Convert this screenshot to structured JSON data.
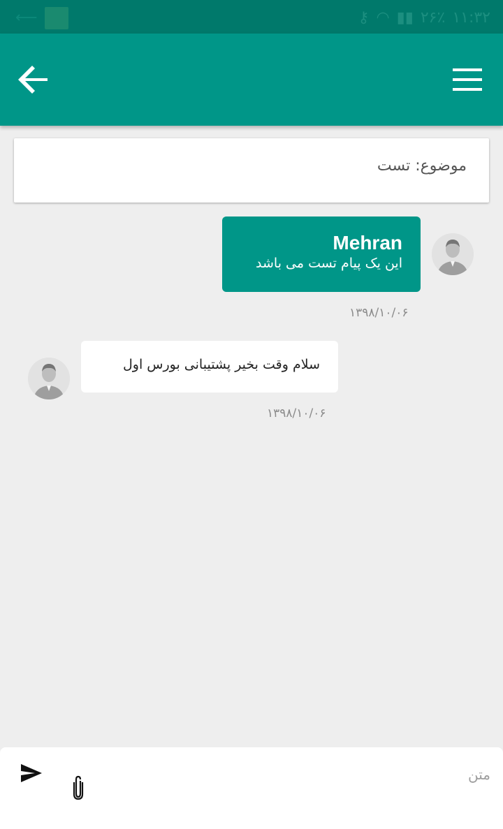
{
  "status_bar": {
    "time": "۱۱:۳۲",
    "battery": "۲۶٪"
  },
  "app_bar": {
    "back_icon": "arrow-back-icon",
    "menu_icon": "hamburger-menu-icon"
  },
  "subject": {
    "text": "موضوع: تست"
  },
  "messages": [
    {
      "direction": "outgoing",
      "sender": "Mehran",
      "text": "این یک پیام تست می باشد",
      "date": "۱۳۹۸/۱۰/۰۶"
    },
    {
      "direction": "incoming",
      "text": "سلام وقت بخیر  پشتیبانی بورس اول",
      "date": "۱۳۹۸/۱۰/۰۶"
    }
  ],
  "composer": {
    "placeholder": "متن",
    "value": "",
    "send_icon": "send-icon",
    "attach_icon": "paperclip-icon"
  },
  "colors": {
    "primary": "#009688",
    "primary_dark": "#00796b",
    "background": "#eeeeee"
  }
}
